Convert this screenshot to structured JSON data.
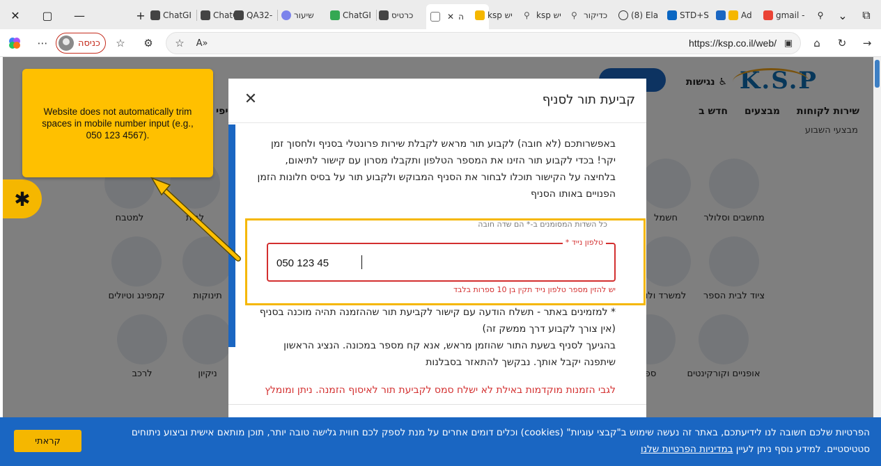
{
  "browser": {
    "window_controls": {
      "close": "✕",
      "maximize": "▢",
      "minimize": "—"
    },
    "new_tab": "+",
    "tabs": [
      {
        "label": "ChatGI",
        "icon": "chatgpt-icon"
      },
      {
        "label": "ChatGl",
        "icon": "chatgpt-icon"
      },
      {
        "label": "QA32-",
        "icon": "chatgpt-icon"
      },
      {
        "label": "שיעור",
        "icon": "zoom-icon"
      },
      {
        "label": "ChatGI",
        "icon": "drive-icon"
      },
      {
        "label": "כרטיס",
        "icon": "chatgpt-icon"
      },
      {
        "label": "ה",
        "icon": "page-icon",
        "active": true
      },
      {
        "label": "ksp יש",
        "icon": "ksp-icon"
      },
      {
        "label": "ksp יש",
        "icon": "search-icon"
      },
      {
        "label": "כדיקור",
        "icon": "search-icon"
      },
      {
        "label": "(8) Ela",
        "icon": "globe-icon"
      },
      {
        "label": "STD+S",
        "icon": "linkedin-icon"
      },
      {
        "label": "Ad",
        "icon": "app-icon"
      },
      {
        "label": "gmail -",
        "icon": "gmail-icon"
      }
    ],
    "profile_label": "כניסה",
    "url": "https://ksp.co.il/web/"
  },
  "site": {
    "logo": "K.S.P",
    "accessibility_label": "נגישות",
    "nav": [
      "שירות לקוחות",
      "מבצעים",
      "חדש ב"
    ],
    "weekly_deals": "מבצעי השבוע",
    "nav_partial_left": "יפי",
    "categories": [
      "מחשבים וסלולר",
      "חשמל",
      "לבית",
      "למטבח",
      "ציוד לבית הספר",
      "למשרד ולו",
      "תינוקות",
      "קמפינג וטיולים",
      "אופניים וקורקינטים",
      "ספ",
      "ניקיון",
      "לרכב"
    ]
  },
  "modal": {
    "title": "קביעת תור לסניף",
    "intro": "באפשרותכם (לא חובה) לקבוע תור מראש לקבלת שירות פרונטלי בסניף ולחסוך זמן יקר! בכדי לקבוע תור הזינו את המספר הטלפון ותקבלו מסרון עם קישור לתיאום, בלחיצה על הקישור תוכלו לבחור את הסניף המבוקש ולקבוע תור על בסיס חלונות הזמן הפנויים באותו הסניף",
    "required_note": "כל השדות המסומנים ב-* הם שדה חובה",
    "phone_label": "טלפון נייד *",
    "phone_value": "050 123 45",
    "phone_error": "יש להזין מספר טלפון נייד תקין בן 10 ספרות בלבד",
    "info_1": "* למזמינים באתר - תשלח הודעה עם קישור לקביעת תור שההזמנה תהיה מוכנה בסניף (אין צורך לקבוע דרך ממשק זה)",
    "info_2": "בהגיעך לסניף בשעת התור שהוזמן מראש, אנא קח מספר במכונה. הנציג הראשון שיתפנה יקבל אותך. נבקשך להתאזר בסבלנות",
    "red_notice": "לגבי הזמנות מוקדמות באילת לא ישלח סמס לקביעת תור לאיסוף הזמנה. ניתן ומומלץ"
  },
  "annotation": {
    "text": "Website does not automatically trim spaces in mobile number input (e.g., 050 123 4567)."
  },
  "cookie_banner": {
    "text": "הפרטיות שלכם חשובה לנו לידיעתכם, באתר זה נעשה שימוש ב\"קבצי עוגיות\" (cookies) וכלים דומים אחרים על מנת לספק לכם חווית גלישה טובה יותר, תוכן מותאם אישית וביצוע ניתוחים סטטיסטיים. למידע נוסף ניתן לעיין ",
    "link": "במדיניות הפרטיות שלנו",
    "button": "קראתי"
  },
  "colors": {
    "ksp_blue": "#1a66c2",
    "highlight_yellow": "#f5b700",
    "error_red": "#d32f2f"
  }
}
